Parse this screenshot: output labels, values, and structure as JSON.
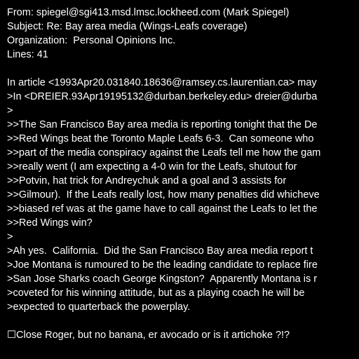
{
  "header": {
    "from": "From: spiegel@sgi413.msd.lmsc.lockheed.com (Mark Spiegel)",
    "subject": "Subject: Re: Bay area media (Wings-Leafs coverage)",
    "organization": "Organization:  Personal Opinions Inc.",
    "lines": "Lines: 41"
  },
  "body": {
    "attribution1": "In article <1993Apr20.031840.18636@ramsey.cs.laurentian.ca> may",
    "attribution2": ">In <DREIER.93Apr19195132@durban.berkeley.edu> dreier@durba",
    "quote_gap1": ">",
    "deep_quote": [
      ">>The San Francisco Bay area media is reporting tonight that the De",
      ">>Red Wings beat the Toronto Maple Leafs 6-3.  Can someone who",
      ">>part of the media conspiracy against the Leafs tell me how the gam",
      ">>really went (I am expecting a 4-0 win for the Leafs, shutout for",
      ">>Potvin, hat trick for Andreychuk and a goal and 3 assists for",
      ">>Gilmour).  If the Leafs really lost, how many penalties did whicheve",
      ">>biased ref was at the game have to call against the Leafs to let the",
      ">>Red Wings win?"
    ],
    "quote_gap2": ">",
    "quote": [
      ">Ah yes.  California.  Did the San Francisco Bay area media report t",
      ">Joe Montana is rumoured to be the leading candidate to replace fire",
      ">San Jose Sharks coach George Kingston?  Apparently Montana is r",
      ">coveted for his winning attitude, but as a playing coach he will be",
      ">expected to quarterback the powerplay."
    ],
    "reply_glyph": "☐",
    "reply": "Close Roger, but no banana, er avocado or is it artichoke ?!?"
  },
  "colors": {
    "background": "#000000",
    "text": "#ffffff"
  }
}
